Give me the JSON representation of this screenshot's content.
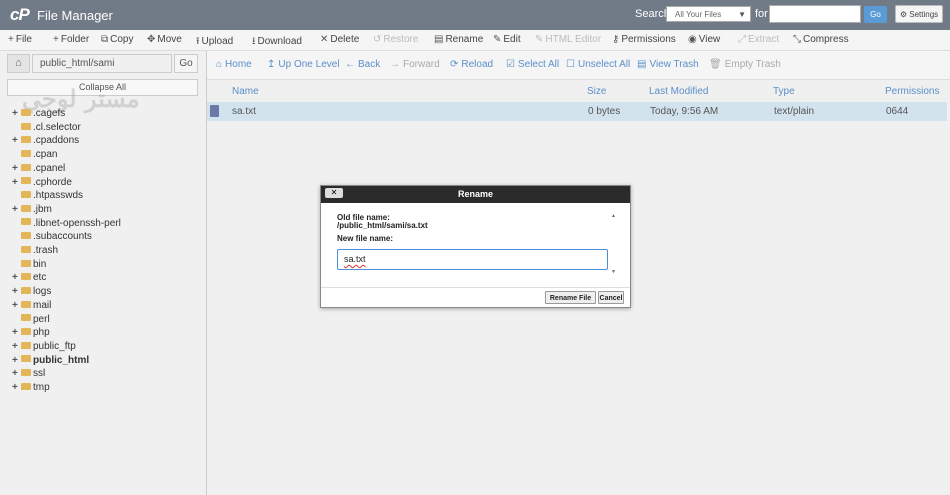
{
  "header": {
    "logo": "cP",
    "title": "File Manager",
    "search_label": "Search",
    "search_scope": "All Your Files",
    "for_label": "for",
    "search_value": "",
    "go_label": "Go",
    "settings_label": "Settings"
  },
  "toolbar": {
    "items": [
      {
        "label": "File",
        "icon": "+",
        "disabled": false
      },
      {
        "label": "Folder",
        "icon": "+",
        "disabled": false
      },
      {
        "label": "Copy",
        "icon": "⧉",
        "disabled": false
      },
      {
        "label": "Move",
        "icon": "✥",
        "disabled": false
      },
      {
        "label": "Upload",
        "icon": "⭱",
        "disabled": false
      },
      {
        "label": "Download",
        "icon": "⭳",
        "disabled": false
      },
      {
        "label": "Delete",
        "icon": "✕",
        "disabled": false
      },
      {
        "label": "Restore",
        "icon": "↺",
        "disabled": true
      },
      {
        "label": "Rename",
        "icon": "▤",
        "disabled": false
      },
      {
        "label": "Edit",
        "icon": "✎",
        "disabled": false
      },
      {
        "label": "HTML Editor",
        "icon": "✎",
        "disabled": true
      },
      {
        "label": "Permissions",
        "icon": "⚷",
        "disabled": false
      },
      {
        "label": "View",
        "icon": "◉",
        "disabled": false
      },
      {
        "label": "Extract",
        "icon": "⤢",
        "disabled": true
      },
      {
        "label": "Compress",
        "icon": "⤡",
        "disabled": false
      }
    ]
  },
  "sidebar": {
    "path_value": "public_html/sami",
    "go_label": "Go",
    "collapse_label": "Collapse All",
    "watermark": "مستر لوجي",
    "tree": [
      {
        "label": ".cagefs",
        "expandable": true,
        "bold": false
      },
      {
        "label": ".cl.selector",
        "expandable": false,
        "bold": false
      },
      {
        "label": ".cpaddons",
        "expandable": true,
        "bold": false
      },
      {
        "label": ".cpan",
        "expandable": false,
        "bold": false
      },
      {
        "label": ".cpanel",
        "expandable": true,
        "bold": false
      },
      {
        "label": ".cphorde",
        "expandable": true,
        "bold": false
      },
      {
        "label": ".htpasswds",
        "expandable": false,
        "bold": false
      },
      {
        "label": ".jbm",
        "expandable": true,
        "bold": false
      },
      {
        "label": ".libnet-openssh-perl",
        "expandable": false,
        "bold": false
      },
      {
        "label": ".subaccounts",
        "expandable": false,
        "bold": false
      },
      {
        "label": ".trash",
        "expandable": false,
        "bold": false
      },
      {
        "label": "bin",
        "expandable": false,
        "bold": false
      },
      {
        "label": "etc",
        "expandable": true,
        "bold": false
      },
      {
        "label": "logs",
        "expandable": true,
        "bold": false
      },
      {
        "label": "mail",
        "expandable": true,
        "bold": false
      },
      {
        "label": "perl",
        "expandable": false,
        "bold": false
      },
      {
        "label": "php",
        "expandable": true,
        "bold": false
      },
      {
        "label": "public_ftp",
        "expandable": true,
        "bold": false
      },
      {
        "label": "public_html",
        "expandable": true,
        "bold": true
      },
      {
        "label": "ssl",
        "expandable": true,
        "bold": false
      },
      {
        "label": "tmp",
        "expandable": true,
        "bold": false
      }
    ]
  },
  "nav": {
    "items": [
      {
        "label": "Home",
        "icon": "⌂",
        "disabled": false
      },
      {
        "label": "Up One Level",
        "icon": "↥",
        "disabled": false
      },
      {
        "label": "Back",
        "icon": "←",
        "disabled": false
      },
      {
        "label": "Forward",
        "icon": "→",
        "disabled": true
      },
      {
        "label": "Reload",
        "icon": "⟳",
        "disabled": false
      },
      {
        "label": "Select All",
        "icon": "☑",
        "disabled": false
      },
      {
        "label": "Unselect All",
        "icon": "☐",
        "disabled": false
      },
      {
        "label": "View Trash",
        "icon": "▤",
        "disabled": false
      },
      {
        "label": "Empty Trash",
        "icon": "🗑",
        "disabled": true
      }
    ]
  },
  "table": {
    "columns": [
      "Name",
      "Size",
      "Last Modified",
      "Type",
      "Permissions"
    ],
    "rows": [
      {
        "name": "sa.txt",
        "size": "0 bytes",
        "modified": "Today, 9:56 AM",
        "type": "text/plain",
        "permissions": "0644"
      }
    ]
  },
  "dialog": {
    "title": "Rename",
    "close_label": "✕",
    "old_label": "Old file name:",
    "old_path": "/public_html/sami/sa.txt",
    "new_label": "New file name:",
    "new_value": "sa.txt",
    "rename_label": "Rename File",
    "cancel_label": "Cancel"
  },
  "colors": {
    "header_bg": "#717a87",
    "accent": "#5b9bd5",
    "link": "#5b8fc9",
    "selected_row": "#d2e3ee",
    "folder": "#e2b659"
  }
}
